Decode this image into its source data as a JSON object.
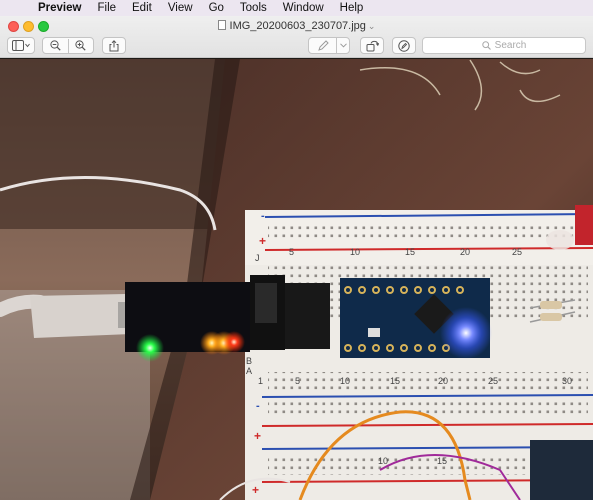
{
  "menubar": {
    "apple_glyph": "",
    "items": [
      "Preview",
      "File",
      "Edit",
      "View",
      "Go",
      "Tools",
      "Window",
      "Help"
    ]
  },
  "window": {
    "title": "IMG_20200603_230707.jpg"
  },
  "toolbar": {
    "search_placeholder": "Search"
  },
  "breadboard": {
    "top_numbers": [
      "5",
      "10",
      "15",
      "20",
      "25"
    ],
    "bottom_numbers": [
      "1",
      "5",
      "10",
      "15",
      "20",
      "25",
      "30"
    ],
    "bottom_numbers_lower": [
      "10",
      "15"
    ],
    "rail_left_top": [
      "-",
      "+"
    ],
    "rail_left_bottom": [
      "-",
      "+",
      "+"
    ],
    "row_letters_top": [
      "J"
    ],
    "row_letters_bottom": [
      "B",
      "A"
    ]
  },
  "colors": {
    "menubar_bg": "#ece6f0",
    "close": "#fd5f57",
    "minimize": "#febc2e",
    "zoom": "#28c840",
    "rail_blue": "#2c4fb0",
    "rail_red": "#cf2a2a",
    "pcb_blue": "#0f2a4a",
    "led_blue": "#3a5cff"
  }
}
